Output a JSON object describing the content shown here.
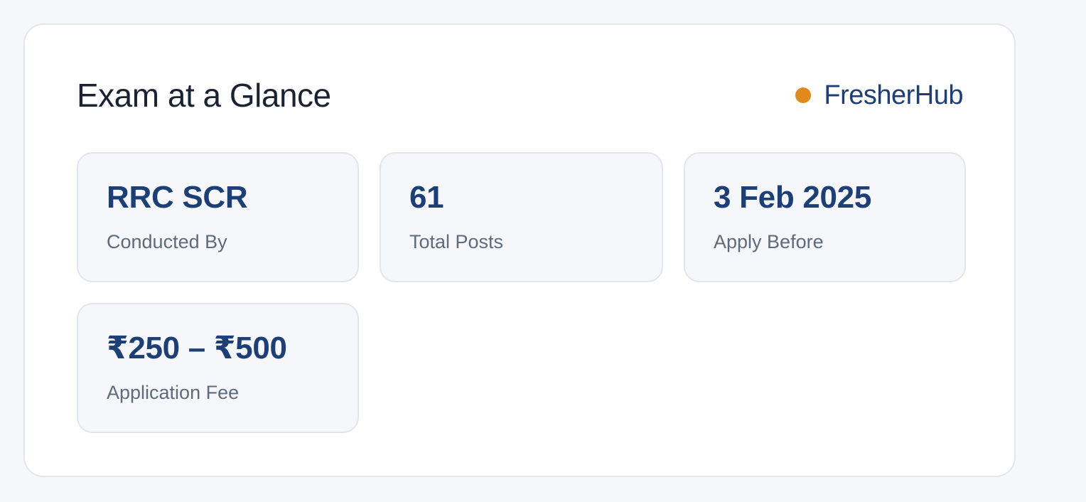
{
  "card": {
    "title": "Exam at a Glance",
    "brand": {
      "name": "FresherHub",
      "dot_color": "#e08a1c",
      "text_color": "#1c3f78"
    }
  },
  "stats": [
    {
      "value": "RRC SCR",
      "label": "Conducted By"
    },
    {
      "value": "61",
      "label": "Total Posts"
    },
    {
      "value": "3 Feb 2025",
      "label": "Apply Before"
    },
    {
      "value": "₹250 – ₹500",
      "label": "Application Fee"
    }
  ],
  "colors": {
    "page_background": "#f5f7fb",
    "card_background": "#ffffff",
    "value_text": "#1c3f78",
    "label_text": "#5e6a7d",
    "title_text": "#1b2333"
  }
}
